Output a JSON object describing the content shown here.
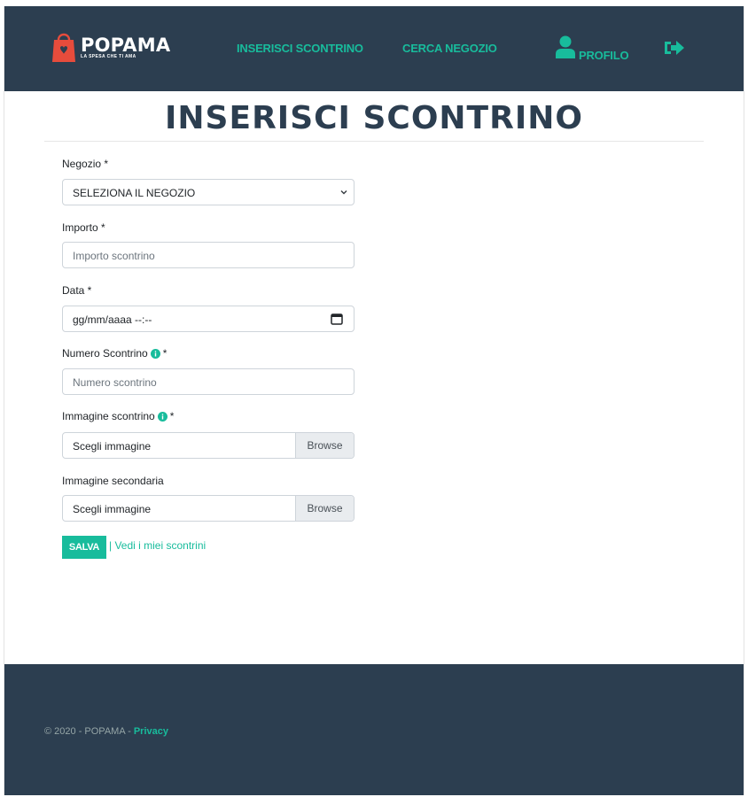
{
  "brand": {
    "name": "POPAMA",
    "tagline": "LA SPESA CHE TI AMA",
    "bag_letter": "♥"
  },
  "nav": {
    "insert_receipt": "INSERISCI SCONTRINO",
    "find_store": "CERCA NEGOZIO",
    "profile": "PROFILO"
  },
  "page": {
    "title": "INSERISCI SCONTRINO"
  },
  "form": {
    "store": {
      "label": "Negozio *",
      "value": "SELEZIONA IL NEGOZIO"
    },
    "amount": {
      "label": "Importo *",
      "placeholder": "Importo scontrino"
    },
    "date": {
      "label": "Data *",
      "placeholder": "gg/mm/aaaa --:--"
    },
    "receipt_number": {
      "label": "Numero Scontrino",
      "required_mark": "*",
      "placeholder": "Numero scontrino"
    },
    "receipt_image": {
      "label": "Immagine scontrino",
      "required_mark": "*",
      "placeholder": "Scegli immagine",
      "browse": "Browse"
    },
    "secondary_image": {
      "label": "Immagine secondaria",
      "placeholder": "Scegli immagine",
      "browse": "Browse"
    },
    "save": "SALVA",
    "my_receipts_link": "| Vedi i miei scontrini"
  },
  "footer": {
    "copyright": "© 2020 - POPAMA - ",
    "privacy": "Privacy"
  },
  "colors": {
    "navbar": "#2c3e50",
    "accent": "#18bc9c",
    "bag": "#e74c3c"
  }
}
